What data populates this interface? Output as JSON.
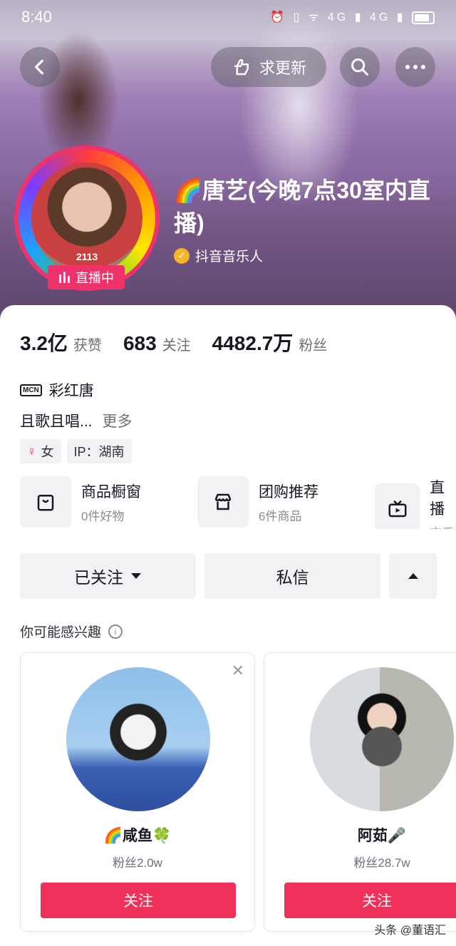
{
  "status_bar": {
    "time": "8:40",
    "icons": "⏰ ▯ ᯤ 4G ▮ 4G ▮"
  },
  "header": {
    "update_label": "求更新",
    "name": "🌈唐艺(今晚7点30室内直播)",
    "verified": "抖音音乐人",
    "live_badge": "直播中",
    "avatar_number": "2113"
  },
  "stats": [
    {
      "value": "3.2亿",
      "label": "获赞"
    },
    {
      "value": "683",
      "label": "关注"
    },
    {
      "value": "4482.7万",
      "label": "粉丝"
    }
  ],
  "mcn": {
    "icon_text": "MCN",
    "name": "彩红唐"
  },
  "bio": {
    "text": "且歌且唱...",
    "more": "更多"
  },
  "tags": {
    "gender": "女",
    "ip": "IP：湖南"
  },
  "shop_items": [
    {
      "title": "商品橱窗",
      "sub": "0件好物",
      "icon": "bag-icon"
    },
    {
      "title": "团购推荐",
      "sub": "6件商品",
      "icon": "store-icon"
    },
    {
      "title": "直播",
      "sub": "查看",
      "icon": "tv-icon"
    }
  ],
  "actions": {
    "followed": "已关注",
    "message": "私信"
  },
  "recommend": {
    "title": "你可能感兴趣",
    "cards": [
      {
        "name": "🌈咸鱼🍀",
        "fans": "粉丝2.0w",
        "follow": "关注"
      },
      {
        "name": "阿茹🎤",
        "fans": "粉丝28.7w",
        "follow": "关注"
      }
    ]
  },
  "watermark": "头条 @董语汇",
  "colors": {
    "accent": "#f0325a",
    "live_pink": "#f0326a",
    "verify_gold": "#f5b526"
  }
}
